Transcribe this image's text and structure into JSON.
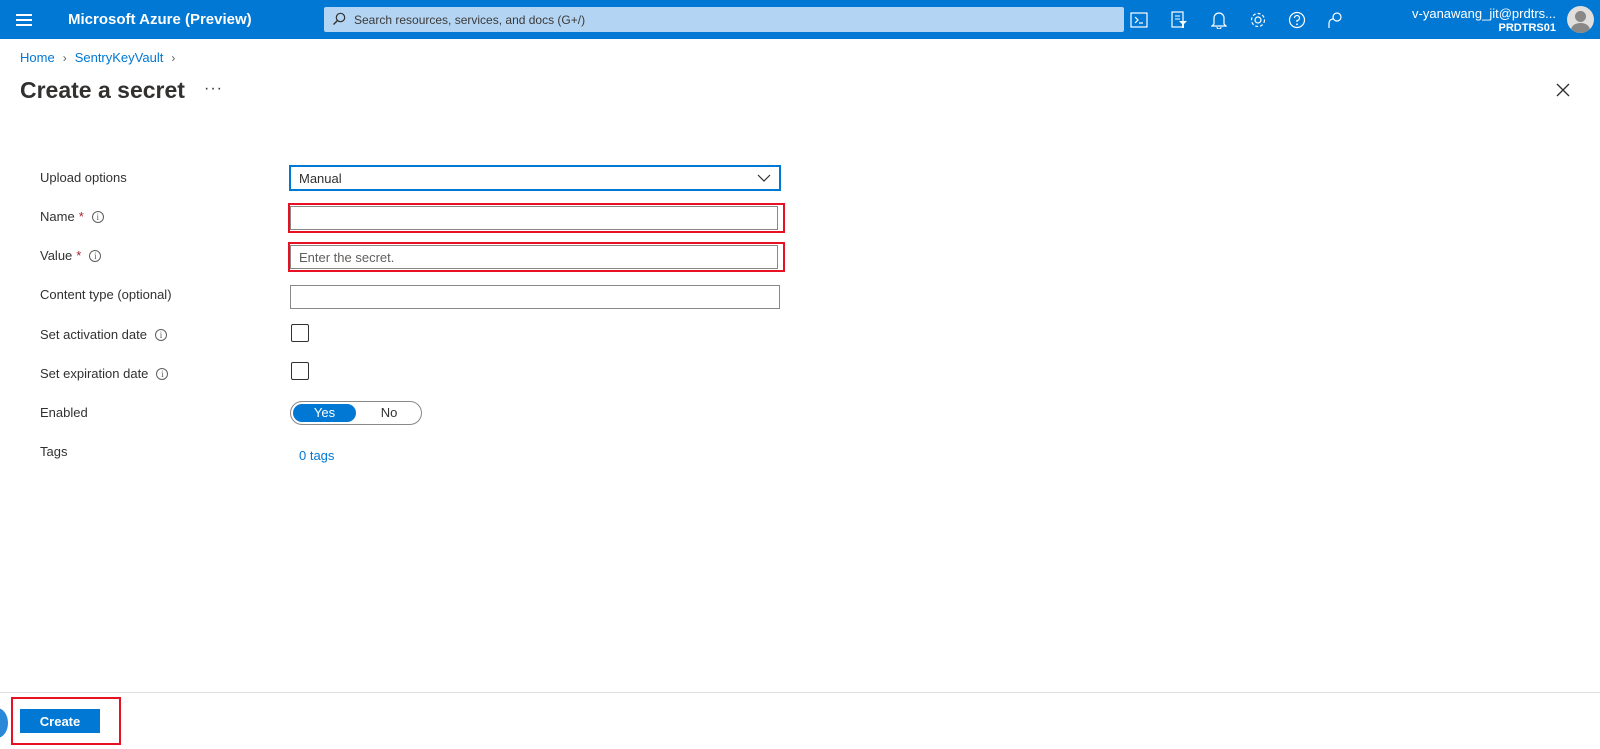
{
  "header": {
    "brand": "Microsoft Azure (Preview)",
    "search_placeholder": "Search resources, services, and docs (G+/)",
    "user_name": "v-yanawang_jit@prdtrs...",
    "user_directory": "PRDTRS01",
    "icons": [
      "menu-icon",
      "cloud-shell-icon",
      "directory-filter-icon",
      "notifications-icon",
      "settings-icon",
      "help-icon",
      "feedback-icon"
    ]
  },
  "breadcrumb": {
    "items": [
      "Home",
      "SentryKeyVault"
    ]
  },
  "page": {
    "title": "Create a secret",
    "more": "···"
  },
  "form": {
    "upload_options": {
      "label": "Upload options",
      "value": "Manual"
    },
    "name": {
      "label": "Name",
      "required": "*",
      "value": ""
    },
    "value": {
      "label": "Value",
      "required": "*",
      "placeholder": "Enter the secret."
    },
    "content_type": {
      "label": "Content type (optional)",
      "value": ""
    },
    "activation": {
      "label": "Set activation date",
      "checked": false
    },
    "expiration": {
      "label": "Set expiration date",
      "checked": false
    },
    "enabled": {
      "label": "Enabled",
      "yes": "Yes",
      "no": "No",
      "selected": "Yes"
    },
    "tags": {
      "label": "Tags",
      "link": "0 tags"
    }
  },
  "footer": {
    "create_label": "Create"
  },
  "colors": {
    "accent": "#0078d4",
    "highlight": "#e81123"
  }
}
